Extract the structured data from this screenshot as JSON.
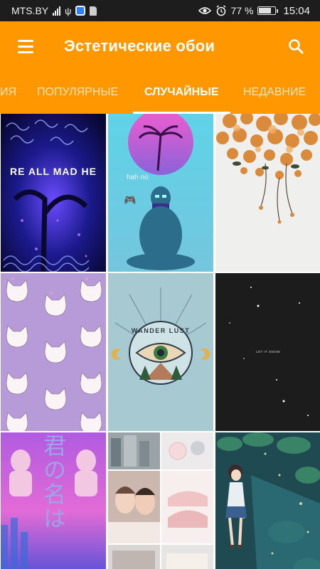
{
  "status_bar": {
    "carrier": "MTS.BY",
    "battery": "77 %",
    "battery_level": 0.77,
    "time": "15:04",
    "icons": [
      "signal-icon",
      "usb-icon",
      "app-notification-icon",
      "sd-card-icon",
      "eye-icon",
      "alarm-icon",
      "battery-icon"
    ]
  },
  "app_bar": {
    "title": "Эстетические обои",
    "menu_icon": "hamburger-menu-icon",
    "search_icon": "search-icon"
  },
  "tabs": [
    {
      "label": "ИЯ",
      "active": false
    },
    {
      "label": "ПОПУЛЯРНЫЕ",
      "active": false
    },
    {
      "label": "СЛУЧАЙНЫЕ",
      "active": true
    },
    {
      "label": "НЕДАВНИЕ",
      "active": false
    }
  ],
  "colors": {
    "accent": "#ff9800",
    "status_bar": "#1d1d1d",
    "tab_inactive": "#ffd79c",
    "tab_active": "#ffffff"
  },
  "wallpapers": {
    "items": [
      {
        "name": "glitch-forest-wallpaper",
        "caption": "RE ALL MAD HE"
      },
      {
        "name": "vaporwave-buddha-wallpaper",
        "caption": "hah no"
      },
      {
        "name": "orange-blossoms-wallpaper",
        "caption": ""
      },
      {
        "name": "cat-pattern-wallpaper",
        "caption": ""
      },
      {
        "name": "wanderlust-eye-wallpaper",
        "caption": "WANDER LUST"
      },
      {
        "name": "snow-night-wallpaper",
        "caption": "LET IT SNOW"
      },
      {
        "name": "vaporwave-statues-wallpaper",
        "caption": "君の名は"
      },
      {
        "name": "aesthetic-collage-wallpaper",
        "caption": ""
      },
      {
        "name": "anime-girl-leaves-wallpaper",
        "caption": ""
      }
    ]
  }
}
